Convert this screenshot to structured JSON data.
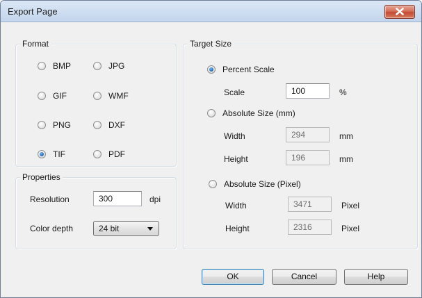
{
  "window": {
    "title": "Export Page"
  },
  "format": {
    "label": "Format",
    "options": [
      "BMP",
      "JPG",
      "GIF",
      "WMF",
      "PNG",
      "DXF",
      "TIF",
      "PDF"
    ],
    "selected": "TIF"
  },
  "properties": {
    "label": "Properties",
    "resolution_label": "Resolution",
    "resolution_value": "300",
    "resolution_unit": "dpi",
    "color_depth_label": "Color depth",
    "color_depth_value": "24 bit"
  },
  "target_size": {
    "label": "Target Size",
    "selected": "Percent Scale",
    "percent": {
      "label": "Percent Scale",
      "scale_label": "Scale",
      "scale_value": "100",
      "unit": "%"
    },
    "absolute_mm": {
      "label": "Absolute Size (mm)",
      "width_label": "Width",
      "width_value": "294",
      "height_label": "Height",
      "height_value": "196",
      "unit": "mm"
    },
    "absolute_px": {
      "label": "Absolute Size (Pixel)",
      "width_label": "Width",
      "width_value": "3471",
      "height_label": "Height",
      "height_value": "2316",
      "unit": "Pixel"
    }
  },
  "buttons": {
    "ok": "OK",
    "cancel": "Cancel",
    "help": "Help"
  }
}
